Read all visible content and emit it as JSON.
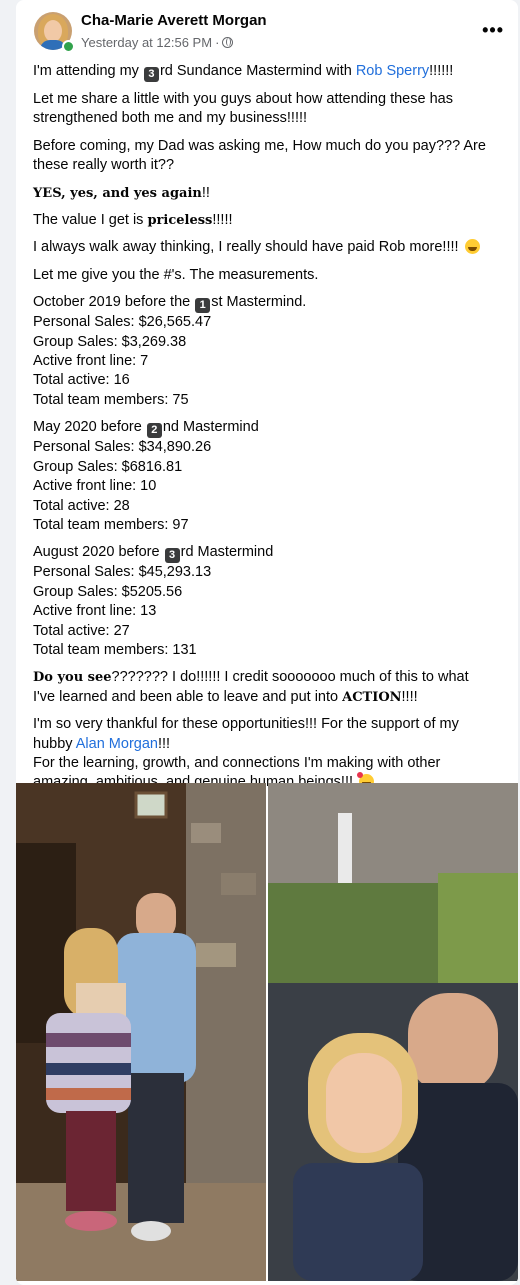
{
  "post": {
    "author": "Cha-Marie Averett Morgan",
    "timestamp": "Yesterday at 12:56 PM",
    "separator": "·",
    "more_label": "•••",
    "avatar_icon": "profile-avatar",
    "privacy_icon": "globe-icon"
  },
  "body": {
    "p1": {
      "a": "I'm attending my ",
      "num": "3",
      "b": "rd Sundance Mastermind with ",
      "link": "Rob Sperry",
      "c": "!!!!!!"
    },
    "p2": "Let me share a little with you guys about how attending these has strengthened both me and my business!!!!!",
    "p2_line1": "Let me share a little with you guys about how attending these has",
    "p2_line2": "strengthened both me and my business!!!!!",
    "p3_line1": "Before coming, my Dad was asking me, How much do you pay??? Are",
    "p3_line2": "these really worth it??",
    "p4": {
      "bold": "YES, yes, and yes again",
      "rest": "!!"
    },
    "p5": {
      "a": "The value I get is ",
      "bold": "priceless",
      "b": "!!!!!"
    },
    "p6": "I always walk away thinking, I really should have paid Rob more!!!! ",
    "p7": "Let me give you the #'s. The measurements.",
    "sections": [
      {
        "title_a": "October 2019 before the ",
        "num": "1",
        "title_b": "st Mastermind.",
        "lines": [
          "Personal Sales: $26,565.47",
          "Group Sales: $3,269.38",
          "Active front line: 7",
          "Total active: 16",
          "Total team members: 75"
        ]
      },
      {
        "title_a": "May 2020 before ",
        "num": "2",
        "title_b": "nd Mastermind",
        "lines": [
          "Personal Sales: $34,890.26",
          "Group Sales: $6816.81",
          "Active front line: 10",
          "Total active: 28",
          "Total team members: 97"
        ]
      },
      {
        "title_a": "August 2020 before ",
        "num": "3",
        "title_b": "rd Mastermind",
        "lines": [
          "Personal Sales: $45,293.13",
          "Group Sales: $5205.56",
          "Active front line: 13",
          "Total active: 27",
          "Total team members: 131"
        ]
      }
    ],
    "p8": {
      "bold": "Do you see",
      "a": "??????? I do!!!!!! I credit sooooooo much of this to what",
      "b": "I've learned and been able to leave and put into ",
      "bold2": "ACTION",
      "c": "!!!!"
    },
    "p9_line1": "I'm so very thankful for these opportunities!!! For the support of my",
    "p9_line2a": "hubby ",
    "p9_link": "Alan Morgan",
    "p9_line2b": "!!!",
    "p9_line3": "For the learning, growth, and connections I'm making with other",
    "p9_line4": "amazing, ambitious, and genuine human beings!!! "
  },
  "colors": {
    "link": "#216fdb",
    "online": "#31a24c",
    "meta_text": "#65676b",
    "page_bg": "#f0f2f5"
  }
}
